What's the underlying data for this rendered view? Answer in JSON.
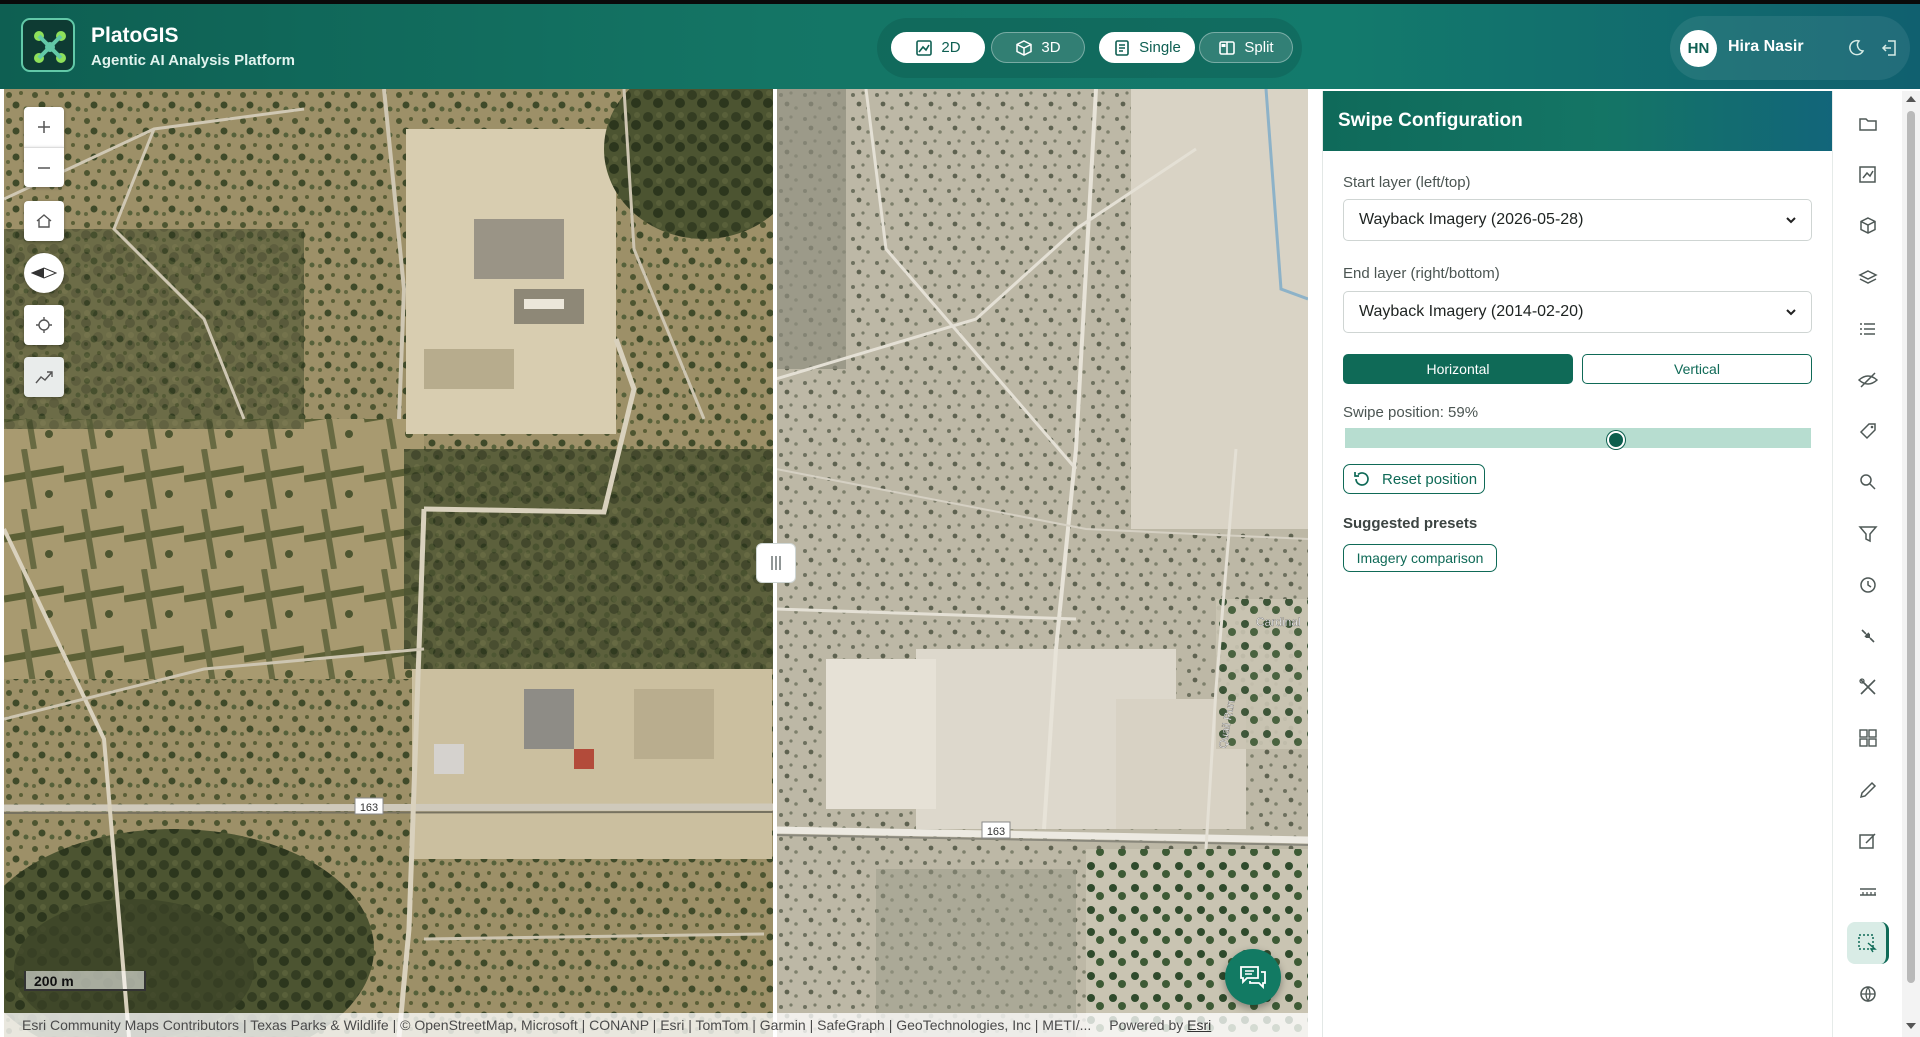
{
  "header": {
    "app_title": "PlatoGIS",
    "app_subtitle": "Agentic AI Analysis Platform",
    "view_buttons": [
      {
        "label": "2D",
        "icon": "map-2d-icon",
        "active": true
      },
      {
        "label": "3D",
        "icon": "cube-icon",
        "active": false
      },
      {
        "label": "Single",
        "icon": "single-view-icon",
        "active": true
      },
      {
        "label": "Split",
        "icon": "split-view-icon",
        "active": false
      }
    ],
    "user": {
      "initials": "HN",
      "name": "Hira Nasir"
    },
    "icons": [
      "moon-icon",
      "logout-icon"
    ]
  },
  "map": {
    "scale_label": "200 m",
    "road_label": "163",
    "place_labels": [
      "Cardinal",
      "Quail Run"
    ],
    "attribution": "Esri Community Maps Contributors | Texas Parks & Wildlife | © OpenStreetMap, Microsoft | CONANP | Esri | TomTom | Garmin | SafeGraph | GeoTechnologies, Inc | METI/...",
    "powered_by": "Powered by",
    "powered_link": "Esri",
    "swipe_fraction": 0.59,
    "tool_icons": [
      "zoom-in-icon",
      "zoom-out-icon",
      "home-icon",
      "compass-icon",
      "locate-icon",
      "measure-icon"
    ]
  },
  "panel": {
    "title": "Swipe Configuration",
    "start_label": "Start layer (left/top)",
    "start_value": "Wayback Imagery (2026-05-28)",
    "end_label": "End layer (right/bottom)",
    "end_value": "Wayback Imagery (2014-02-20)",
    "horizontal_label": "Horizontal",
    "vertical_label": "Vertical",
    "position_label": "Swipe position: 59%",
    "position_value": 59,
    "reset_label": "Reset position",
    "presets_title": "Suggested presets",
    "preset_chip": "Imagery comparison"
  },
  "toolbar": {
    "items": [
      "folder-icon",
      "map-edit-icon",
      "cube-icon",
      "layers-icon",
      "list-icon",
      "eye-off-icon",
      "tag-icon",
      "search-icon",
      "filter-icon",
      "clock-icon",
      "satellite-icon",
      "tools-icon",
      "grid-icon",
      "pencil-icon",
      "edit-icon",
      "ruler-icon",
      "select-area-icon",
      "globe-icon"
    ],
    "active_index": 16
  },
  "colors": {
    "brand": "#0f6a57",
    "header_start": "#0e5f52",
    "header_end": "#10606f",
    "track": "#b7ddd0"
  }
}
